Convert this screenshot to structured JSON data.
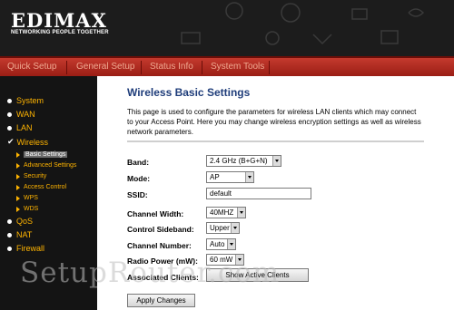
{
  "header": {
    "logo_text": "EDIMAX",
    "tagline": "NETWORKING PEOPLE TOGETHER"
  },
  "menu": {
    "items": [
      "Quick Setup",
      "General Setup",
      "Status Info",
      "System Tools"
    ]
  },
  "sidebar": {
    "items": [
      {
        "label": "System"
      },
      {
        "label": "WAN"
      },
      {
        "label": "LAN"
      },
      {
        "label": "Wireless"
      },
      {
        "label": "QoS"
      },
      {
        "label": "NAT"
      },
      {
        "label": "Firewall"
      }
    ],
    "wireless_sub": [
      {
        "label": "Basic Settings"
      },
      {
        "label": "Advanced Settings"
      },
      {
        "label": "Security"
      },
      {
        "label": "Access Control"
      },
      {
        "label": "WPS"
      },
      {
        "label": "WDS"
      }
    ]
  },
  "page": {
    "title": "Wireless Basic Settings",
    "description": "This page is used to configure the parameters for wireless LAN clients which may connect to your Access Point. Here you may change wireless encryption settings as well as wireless network parameters."
  },
  "form": {
    "band_label": "Band:",
    "band_value": "2.4 GHz (B+G+N)",
    "mode_label": "Mode:",
    "mode_value": "AP",
    "ssid_label": "SSID:",
    "ssid_value": "default",
    "channel_width_label": "Channel Width:",
    "channel_width_value": "40MHZ",
    "control_sideband_label": "Control Sideband:",
    "control_sideband_value": "Upper",
    "channel_number_label": "Channel Number:",
    "channel_number_value": "Auto",
    "radio_power_label": "Radio Power (mW):",
    "radio_power_value": "60 mW",
    "associated_clients_label": "Associated Clients:",
    "show_clients_button": "Show Active Clients",
    "apply_button": "Apply Changes"
  },
  "watermark": "SetupRouter.com"
}
